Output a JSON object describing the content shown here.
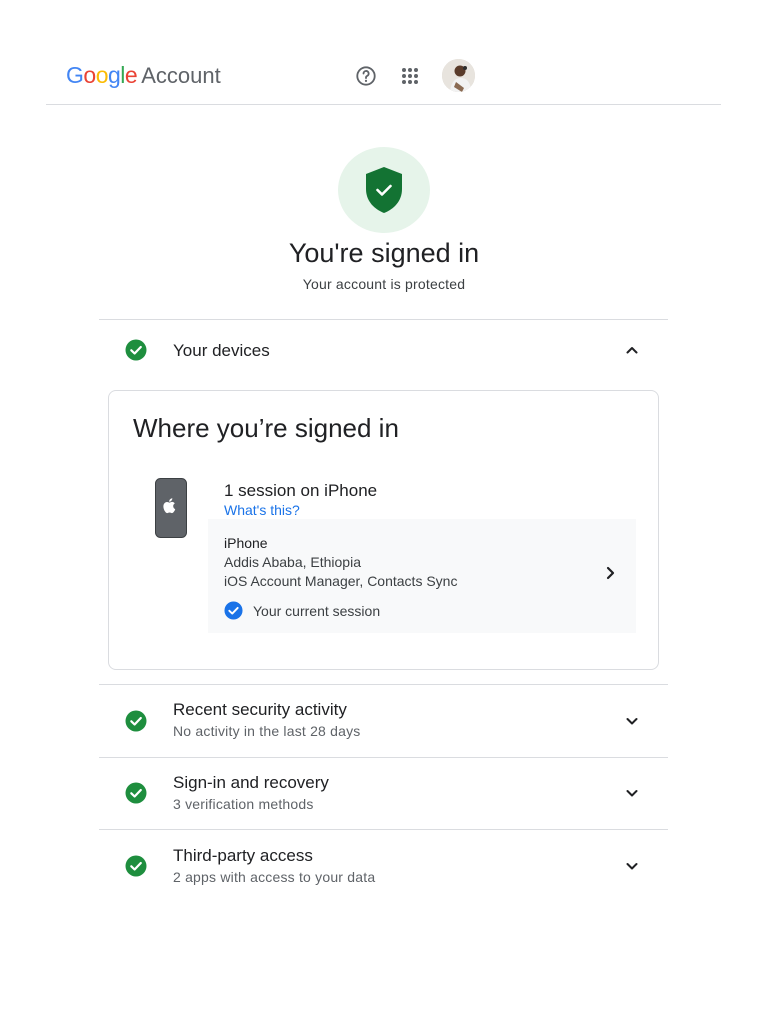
{
  "header": {
    "brand_letters": [
      {
        "char": "G",
        "color": "#4285F4"
      },
      {
        "char": "o",
        "color": "#EA4335"
      },
      {
        "char": "o",
        "color": "#FBBC05"
      },
      {
        "char": "g",
        "color": "#4285F4"
      },
      {
        "char": "l",
        "color": "#34A853"
      },
      {
        "char": "e",
        "color": "#EA4335"
      }
    ],
    "product": "Account",
    "icons": [
      "help-icon",
      "apps-grid-icon",
      "avatar"
    ]
  },
  "hero": {
    "title": "You're signed in",
    "subtitle": "Your account is protected",
    "icon": "shield-check-icon"
  },
  "sections": {
    "devices": {
      "title": "Your devices",
      "expanded": true
    },
    "security": {
      "title": "Recent security activity",
      "subtitle": "No activity in the last 28 days"
    },
    "signin": {
      "title": "Sign-in and recovery",
      "subtitle": "3 verification methods"
    },
    "thirdparty": {
      "title": "Third-party access",
      "subtitle": "2 apps with access to your data"
    }
  },
  "devices_card": {
    "title": "Where you’re signed in",
    "session_title": "1 session on iPhone",
    "whats_this": "What's this?",
    "device": {
      "name": "iPhone",
      "location": "Addis Ababa, Ethiopia",
      "apps": "iOS Account Manager, Contacts Sync",
      "current_label": "Your current session"
    }
  },
  "colors": {
    "accent": "#1a73e8",
    "success": "#1e8e3e",
    "shield": "#137333",
    "shield_bg": "#e6f4ea"
  }
}
